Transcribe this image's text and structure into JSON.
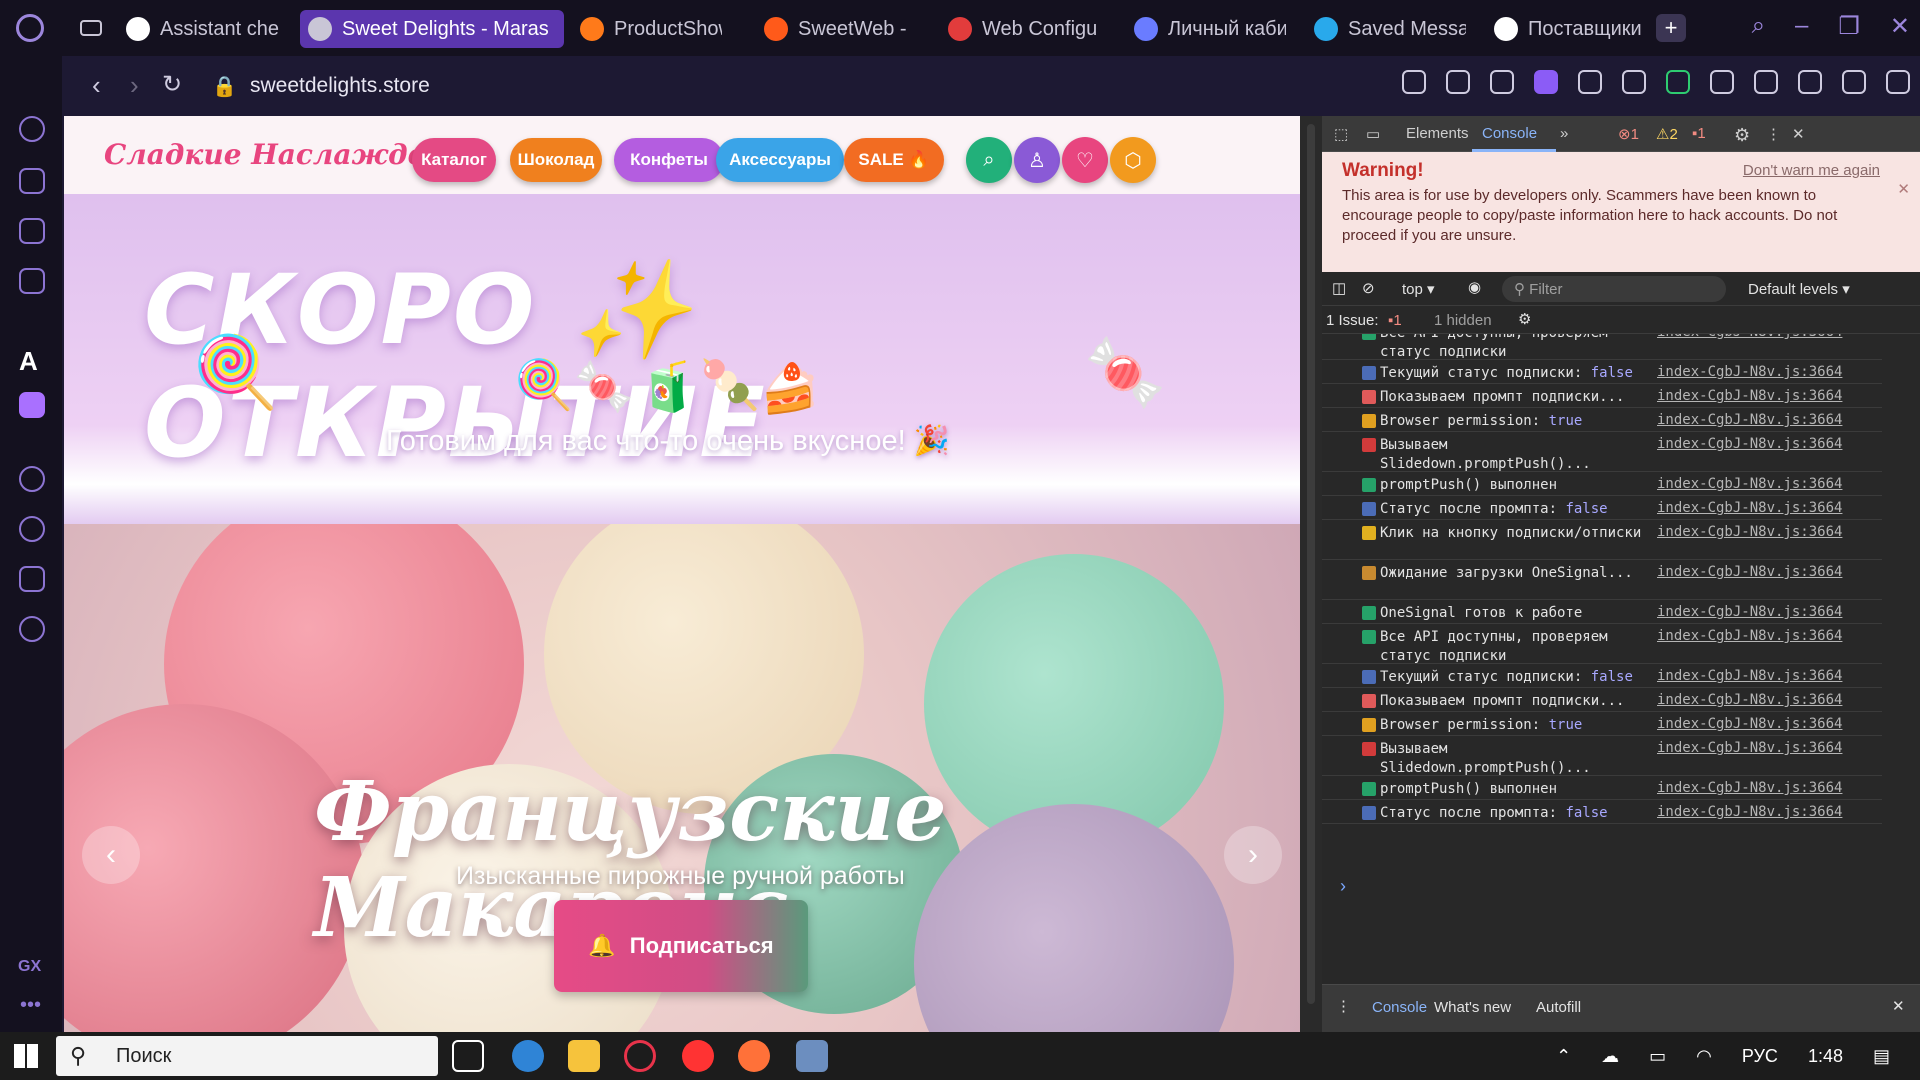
{
  "tabs": [
    {
      "label": "Assistant che",
      "active": false,
      "color": "#ffffff"
    },
    {
      "label": "Sweet Delights - Maras",
      "active": true,
      "color": "#c9c6d6"
    },
    {
      "label": "ProductShow",
      "active": false,
      "color": "#ff7a1a"
    },
    {
      "label": "SweetWeb -",
      "active": false,
      "color": "#ff5a1a"
    },
    {
      "label": "Web Configu",
      "active": false,
      "color": "#e23c3c"
    },
    {
      "label": "Личный каби",
      "active": false,
      "color": "#6a7cff"
    },
    {
      "label": "Saved Messa",
      "active": false,
      "color": "#29a9eb"
    },
    {
      "label": "Поставщики",
      "active": false,
      "color": "#ffffff"
    }
  ],
  "address": {
    "url": "sweetdelights.store"
  },
  "site": {
    "logo": "Сладкие Наслаждения",
    "nav": [
      {
        "label": "Каталог",
        "color": "#e44a84"
      },
      {
        "label": "Шоколад",
        "color": "#f0801e"
      },
      {
        "label": "Конфеты",
        "color": "#b45de0"
      },
      {
        "label": "Аксессуары",
        "color": "#3aa4e8"
      },
      {
        "label": "SALE 🔥",
        "color": "#f26c22"
      }
    ],
    "icons": [
      {
        "name": "search-icon",
        "glyph": "⌕",
        "color": "#22b07a"
      },
      {
        "name": "user-icon",
        "glyph": "♙",
        "color": "#8a5ad6"
      },
      {
        "name": "heart-icon",
        "glyph": "♡",
        "color": "#e8457f"
      },
      {
        "name": "cart-icon",
        "glyph": "⬡",
        "color": "#f29a1e"
      }
    ],
    "hero": {
      "title": "СКОРО  ✨  ОТКРЫТИЕ",
      "subtitle": "Готовим для вас что-то очень вкусное! 🎉"
    },
    "slide": {
      "title": "Французские Макаронс",
      "subtitle": "Изысканные пирожные ручной работы",
      "button": "Подписаться",
      "prev": "‹",
      "next": "›"
    }
  },
  "devtools": {
    "tabs": [
      "Elements",
      "Console"
    ],
    "counts": {
      "errors": "1",
      "warnings": "2",
      "issues": "1"
    },
    "warning": {
      "title": "Warning!",
      "dont_warn": "Don't warn me again",
      "body": "This area is for use by developers only. Scammers have been known to encourage people to copy/paste information here to hack accounts. Do not proceed if you are unsure."
    },
    "filter": {
      "context": "top",
      "placeholder": "Filter",
      "levels": "Default levels"
    },
    "issues": {
      "label": "1 Issue:",
      "count": "1",
      "hidden": "1 hidden"
    },
    "logs": [
      {
        "icon": "✅",
        "text": "Все API доступны, проверяем статус подписки",
        "value": "",
        "src": "index-CgbJ-N8v.js:3664"
      },
      {
        "icon": "📊",
        "text": "Текущий статус подписки:",
        "value": "false",
        "src": "index-CgbJ-N8v.js:3664"
      },
      {
        "icon": "🚀",
        "text": "Показываем промпт подписки...",
        "value": "",
        "src": "index-CgbJ-N8v.js:3664"
      },
      {
        "icon": "🔓",
        "text": "Browser permission:",
        "value": "true",
        "src": "index-CgbJ-N8v.js:3664"
      },
      {
        "icon": "🎯",
        "text": "Вызываем Slidedown.promptPush()...",
        "value": "",
        "src": "index-CgbJ-N8v.js:3664"
      },
      {
        "icon": "✅",
        "text": "promptPush() выполнен",
        "value": "",
        "src": "index-CgbJ-N8v.js:3664"
      },
      {
        "icon": "📊",
        "text": "Статус после промпта:",
        "value": "false",
        "src": "index-CgbJ-N8v.js:3664"
      },
      {
        "icon": "🔔",
        "text": "Клик на кнопку подписки/отписки",
        "value": "",
        "src": "index-CgbJ-N8v.js:3664"
      },
      {
        "icon": "⏳",
        "text": "Ожидание загрузки OneSignal...",
        "value": "",
        "src": "index-CgbJ-N8v.js:3664"
      },
      {
        "icon": "✅",
        "text": "OneSignal готов к работе",
        "value": "",
        "src": "index-CgbJ-N8v.js:3664"
      },
      {
        "icon": "✅",
        "text": "Все API доступны, проверяем статус подписки",
        "value": "",
        "src": "index-CgbJ-N8v.js:3664"
      },
      {
        "icon": "📊",
        "text": "Текущий статус подписки:",
        "value": "false",
        "src": "index-CgbJ-N8v.js:3664"
      },
      {
        "icon": "🚀",
        "text": "Показываем промпт подписки...",
        "value": "",
        "src": "index-CgbJ-N8v.js:3664"
      },
      {
        "icon": "🔓",
        "text": "Browser permission:",
        "value": "true",
        "src": "index-CgbJ-N8v.js:3664"
      },
      {
        "icon": "🎯",
        "text": "Вызываем Slidedown.promptPush()...",
        "value": "",
        "src": "index-CgbJ-N8v.js:3664"
      },
      {
        "icon": "✅",
        "text": "promptPush() выполнен",
        "value": "",
        "src": "index-CgbJ-N8v.js:3664"
      },
      {
        "icon": "📊",
        "text": "Статус после промпта:",
        "value": "false",
        "src": "index-CgbJ-N8v.js:3664"
      }
    ],
    "drawer": [
      "Console",
      "What's new",
      "Autofill"
    ]
  },
  "taskbar": {
    "search": "Поиск",
    "lang": "РУС",
    "time": "1:48"
  }
}
